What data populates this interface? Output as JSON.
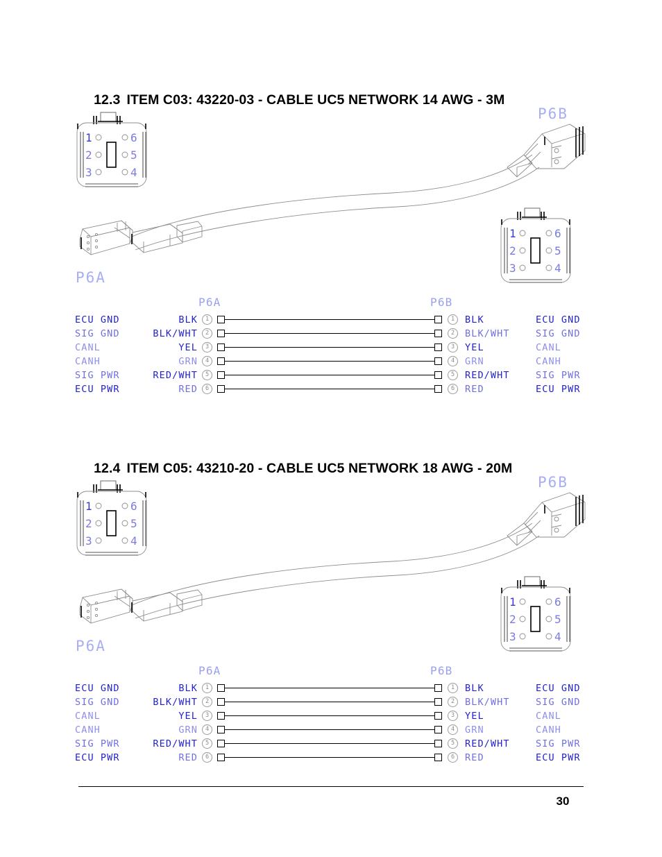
{
  "page": {
    "number": "30"
  },
  "sections": [
    {
      "id": "section-12-3",
      "number": "12.3",
      "title": "ITEM C03: 43220-03 - CABLE UC5 NETWORK 14 AWG - 3M",
      "diagram": {
        "connector_a_label": "P6A",
        "connector_b_label": "P6B",
        "face_view_pins_left": [
          "1",
          "2",
          "3"
        ],
        "face_view_pins_right": [
          "6",
          "5",
          "4"
        ],
        "table": {
          "left_header": "P6A",
          "right_header": "P6B",
          "rows": [
            {
              "pin": "1",
              "function_left": "ECU GND",
              "color_left": "BLK",
              "color_right": "BLK",
              "function_right": "ECU GND"
            },
            {
              "pin": "2",
              "function_left": "SIG GND",
              "color_left": "BLK/WHT",
              "color_right": "BLK/WHT",
              "function_right": "SIG GND"
            },
            {
              "pin": "3",
              "function_left": "CANL",
              "color_left": "YEL",
              "color_right": "YEL",
              "function_right": "CANL"
            },
            {
              "pin": "4",
              "function_left": "CANH",
              "color_left": "GRN",
              "color_right": "GRN",
              "function_right": "CANH"
            },
            {
              "pin": "5",
              "function_left": "SIG PWR",
              "color_left": "RED/WHT",
              "color_right": "RED/WHT",
              "function_right": "SIG PWR"
            },
            {
              "pin": "6",
              "function_left": "ECU PWR",
              "color_left": "RED",
              "color_right": "RED",
              "function_right": "ECU PWR"
            }
          ]
        }
      }
    },
    {
      "id": "section-12-4",
      "number": "12.4",
      "title": "ITEM C05: 43210-20 - CABLE UC5 NETWORK 18 AWG - 20M",
      "diagram": {
        "connector_a_label": "P6A",
        "connector_b_label": "P6B",
        "face_view_pins_left": [
          "1",
          "2",
          "3"
        ],
        "face_view_pins_right": [
          "6",
          "5",
          "4"
        ],
        "table": {
          "left_header": "P6A",
          "right_header": "P6B",
          "rows": [
            {
              "pin": "1",
              "function_left": "ECU GND",
              "color_left": "BLK",
              "color_right": "BLK",
              "function_right": "ECU GND"
            },
            {
              "pin": "2",
              "function_left": "SIG GND",
              "color_left": "BLK/WHT",
              "color_right": "BLK/WHT",
              "function_right": "SIG GND"
            },
            {
              "pin": "3",
              "function_left": "CANL",
              "color_left": "YEL",
              "color_right": "YEL",
              "function_right": "CANL"
            },
            {
              "pin": "4",
              "function_left": "CANH",
              "color_left": "GRN",
              "color_right": "GRN",
              "function_right": "CANH"
            },
            {
              "pin": "5",
              "function_left": "SIG PWR",
              "color_left": "RED/WHT",
              "color_right": "RED/WHT",
              "function_right": "SIG PWR"
            },
            {
              "pin": "6",
              "function_left": "ECU PWR",
              "color_left": "RED",
              "color_right": "RED",
              "function_right": "ECU PWR"
            }
          ]
        }
      }
    }
  ],
  "colors": {
    "text_blue": "#2222cc",
    "label_periwinkle": "#a8aef5",
    "line_black": "#000000",
    "art_gray": "#8d8d8d"
  }
}
